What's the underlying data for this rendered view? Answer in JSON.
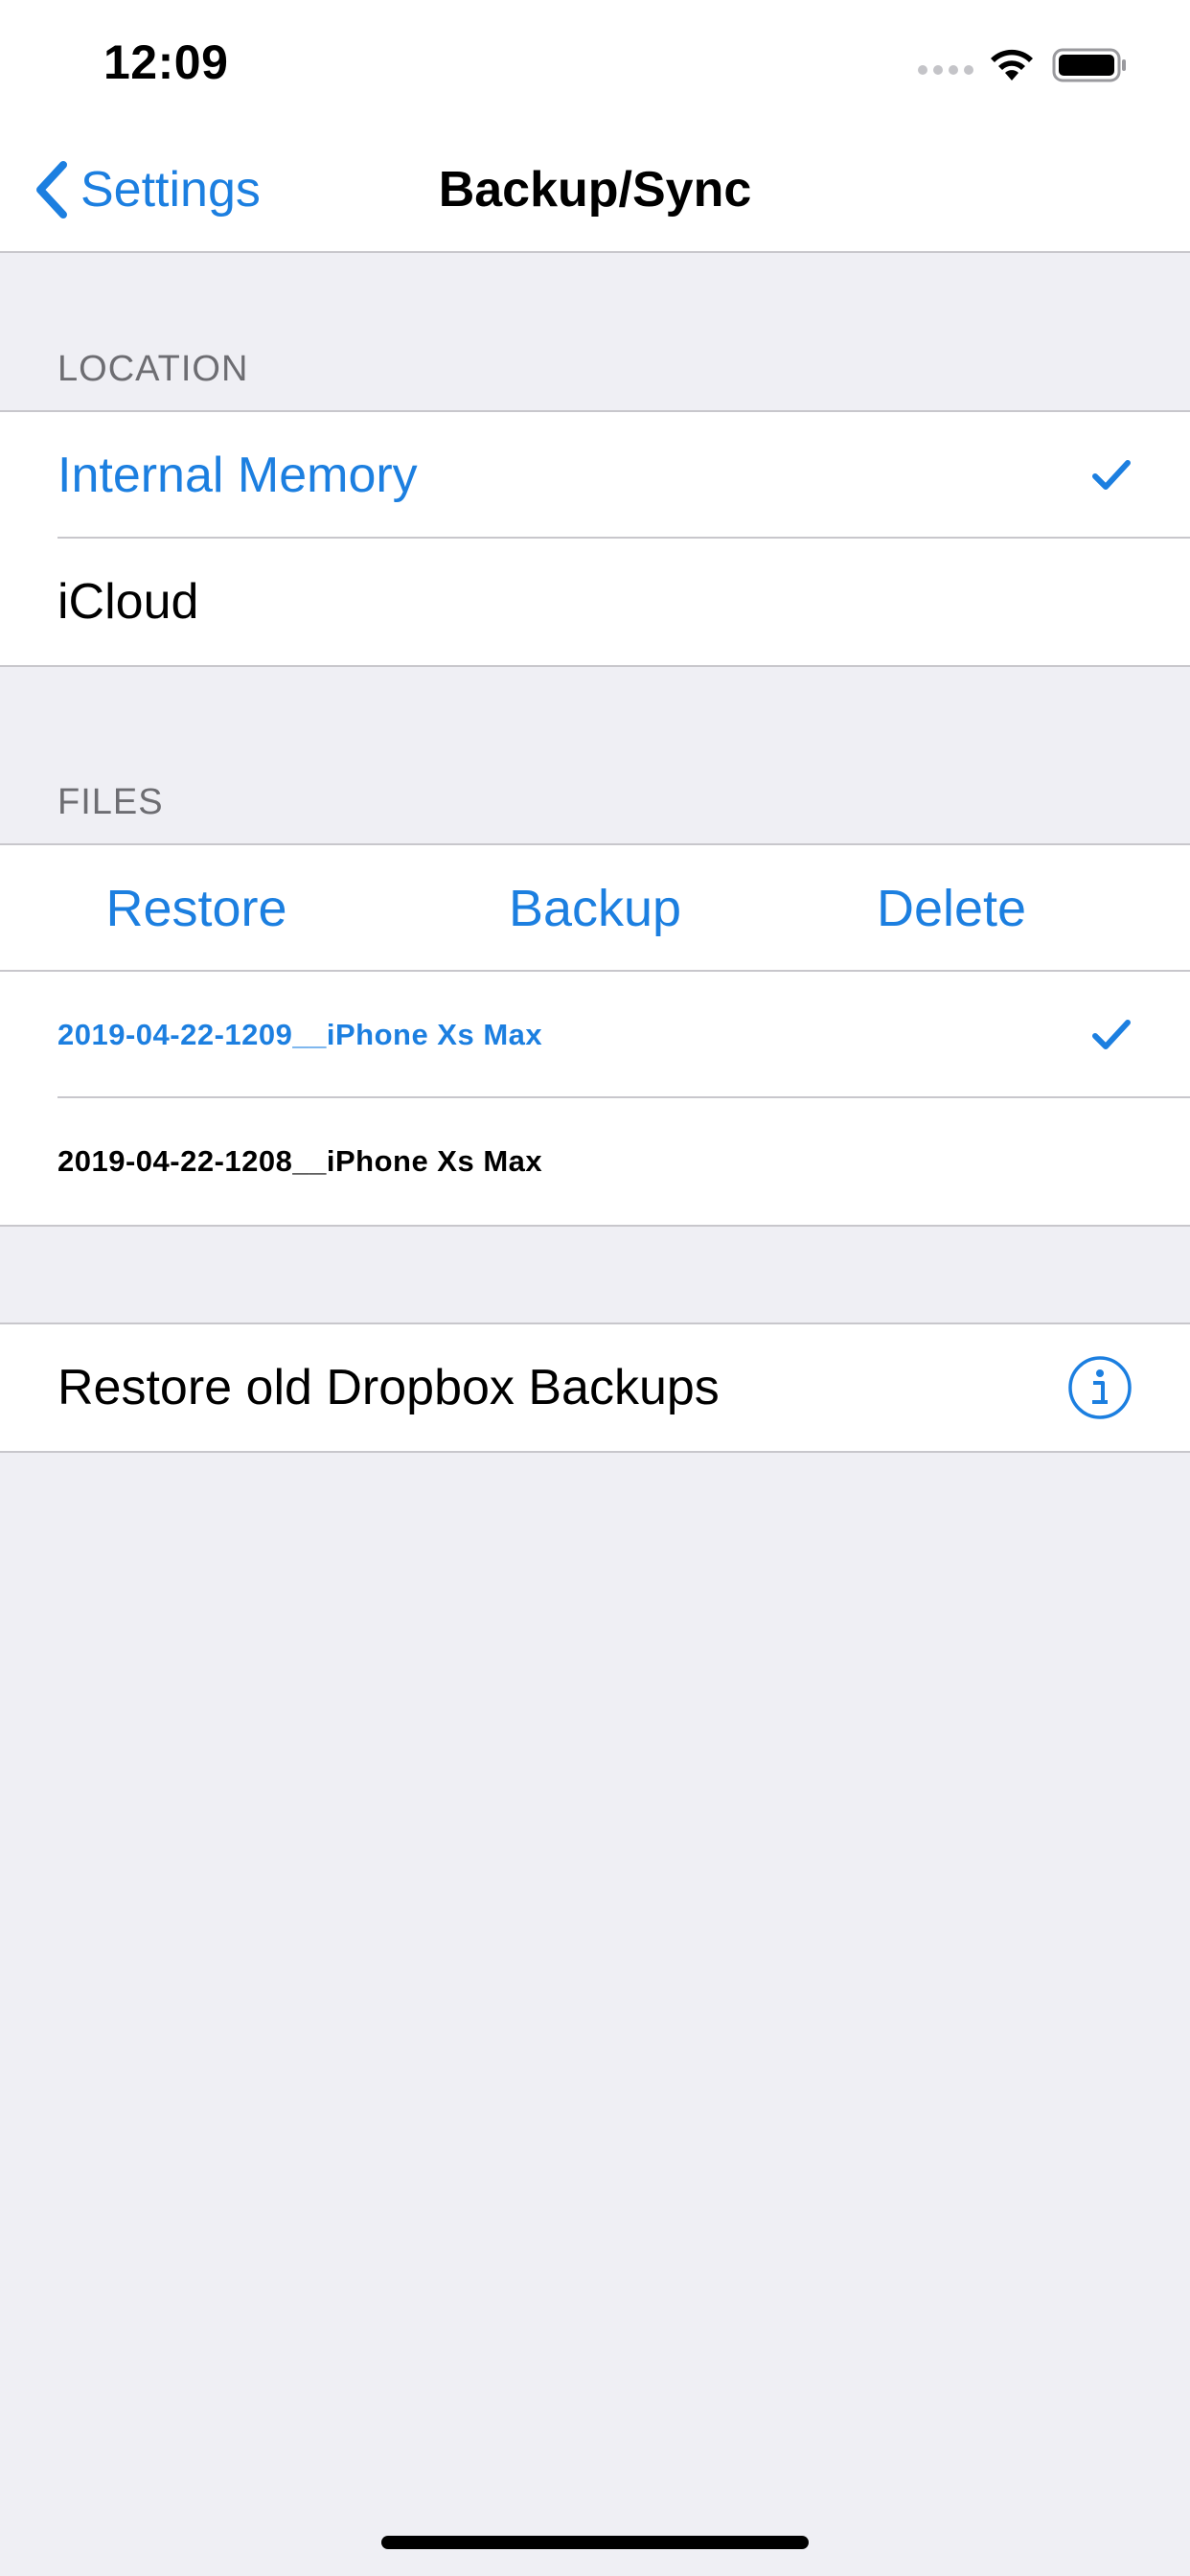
{
  "status_bar": {
    "time": "12:09"
  },
  "nav": {
    "back_label": "Settings",
    "title": "Backup/Sync"
  },
  "location": {
    "header": "LOCATION",
    "items": [
      {
        "label": "Internal Memory",
        "selected": true
      },
      {
        "label": "iCloud",
        "selected": false
      }
    ]
  },
  "files": {
    "header": "FILES",
    "actions": {
      "restore": "Restore",
      "backup": "Backup",
      "delete": "Delete"
    },
    "items": [
      {
        "label": "2019-04-22-1209__iPhone Xs Max",
        "selected": true
      },
      {
        "label": "2019-04-22-1208__iPhone Xs Max",
        "selected": false
      }
    ]
  },
  "dropbox": {
    "label": "Restore old Dropbox Backups",
    "icon": "info-icon"
  },
  "colors": {
    "accent": "#1c7fe0",
    "background": "#efeff4",
    "separator": "#c8c7cc",
    "header_text": "#6d6d72"
  }
}
